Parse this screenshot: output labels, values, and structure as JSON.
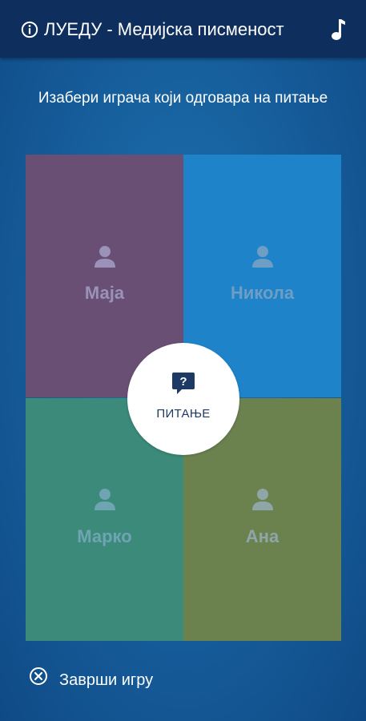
{
  "header": {
    "title": "ЛУЕДУ - Медијска писменост",
    "info_icon": "info-icon",
    "music_icon": "music-note-icon",
    "background_color": "#0e2f5e"
  },
  "instruction": "Изабери играча који одговара на питање",
  "players": [
    {
      "name": "Маја",
      "color": "#6a4f75",
      "icon": "person-icon"
    },
    {
      "name": "Никола",
      "color": "#1e83c9",
      "icon": "person-icon"
    },
    {
      "name": "Марко",
      "color": "#3c8a7a",
      "icon": "person-icon"
    },
    {
      "name": "Ана",
      "color": "#6b824f",
      "icon": "person-icon"
    }
  ],
  "question_button": {
    "label": "ПИТАЊЕ",
    "icon": "question-bubble-icon"
  },
  "end_game": {
    "label": "Заврши игру",
    "icon": "close-circle-icon"
  }
}
